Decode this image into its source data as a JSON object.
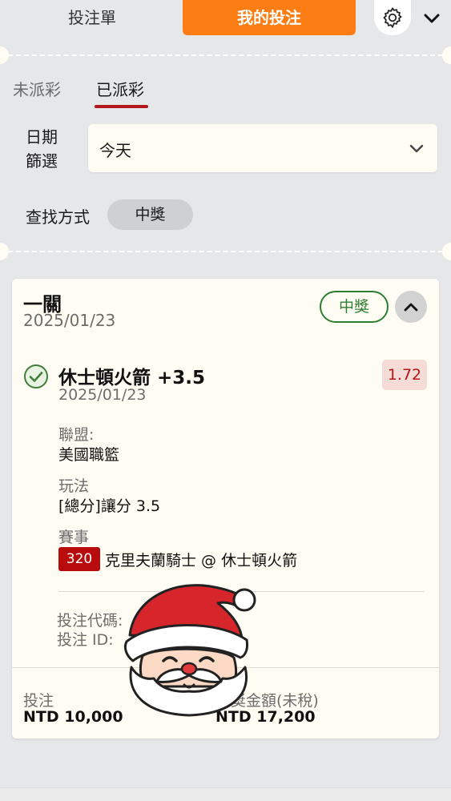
{
  "header": {
    "tab_betslip": "投注單",
    "tab_mybets": "我的投注",
    "colors": {
      "accent": "#fb7d14"
    },
    "icons": {
      "settings": "gear-icon",
      "menu": "chevron-down-icon"
    }
  },
  "settle_tabs": {
    "unsettled": "未派彩",
    "settled": "已派彩",
    "active": "settled",
    "underline_color": "#b3171b"
  },
  "filter": {
    "date_label": "日期\n篩選",
    "date_value": "今天",
    "search_label": "查找方式",
    "search_chip": "中獎"
  },
  "bet": {
    "type": "一關",
    "date": "2025/01/23",
    "status": "中獎",
    "status_color": "#2e7d32",
    "selection": {
      "name": "休士頓火箭 +3.5",
      "date": "2025/01/23",
      "odds": "1.72",
      "league_label": "聯盟:",
      "league": "美國職籃",
      "market_label": "玩法",
      "market": "[總分]讓分 3.5",
      "event_label": "賽事",
      "match_no": "320",
      "match": "克里夫蘭騎士 @ 休士頓火箭"
    },
    "bet_code_label": "投注代碼:",
    "bet_id_label": "投注 ID:",
    "stake_label": "投注",
    "stake": "NTD 10,000",
    "winnings_label": "中獎金額(未稅)",
    "winnings": "NTD 17,200"
  }
}
